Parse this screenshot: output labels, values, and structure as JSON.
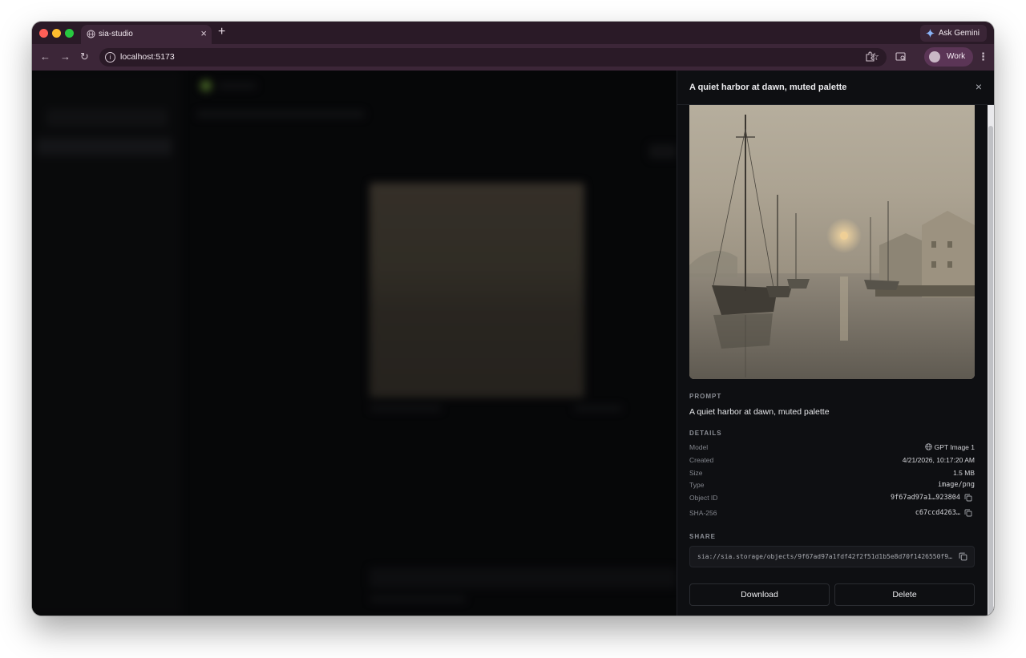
{
  "browser": {
    "tab_title": "sia-studio",
    "tab_close": "×",
    "new_tab": "+",
    "ask_gemini": "Ask Gemini",
    "url": "localhost:5173",
    "profile": "Work"
  },
  "panel": {
    "title": "A quiet harbor at dawn, muted palette",
    "close": "×",
    "prompt_label": "PROMPT",
    "prompt": "A quiet harbor at dawn, muted palette",
    "details_label": "DETAILS",
    "details": [
      {
        "key": "Model",
        "value": "GPT Image 1"
      },
      {
        "key": "Created",
        "value": "4/21/2026, 10:17:20 AM"
      },
      {
        "key": "Size",
        "value": "1.5 MB"
      },
      {
        "key": "Type",
        "value": "image/png"
      },
      {
        "key": "Object ID",
        "value": "9f67ad97a1…923804"
      },
      {
        "key": "SHA-256",
        "value": "c67ccd4263…"
      }
    ],
    "share_label": "SHARE",
    "share_url": "sia://sia.storage/objects/9f67ad97a1fdf42f2f51d1b5e8d70f1426550f94…",
    "download": "Download",
    "delete": "Delete"
  },
  "colors": {
    "tab_strip": "#2a1a27",
    "toolbar": "#3c2638",
    "panel_bg": "#0e0f12",
    "profile_pill": "#5b3556"
  }
}
